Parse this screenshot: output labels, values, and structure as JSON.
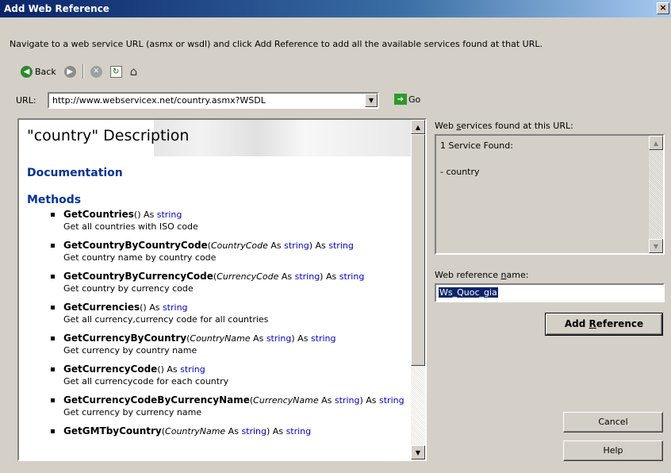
{
  "window": {
    "title": "Add Web Reference",
    "close_label": "×"
  },
  "instruction": "Navigate to a web service URL (asmx or wsdl) and click Add Reference to add all the available services found at that URL.",
  "toolbar": {
    "back_label": "Back"
  },
  "url": {
    "label": "URL:",
    "value": "http://www.webservicex.net/country.asmx?WSDL",
    "go_label": "Go"
  },
  "browser": {
    "title": "\"country\" Description",
    "documentation_heading": "Documentation",
    "methods_heading": "Methods",
    "methods": [
      {
        "name": "GetCountries",
        "params": [],
        "returns": "string",
        "description": "Get all countries with ISO code"
      },
      {
        "name": "GetCountryByCountryCode",
        "params": [
          {
            "name": "CountryCode",
            "type": "string"
          }
        ],
        "returns": "string",
        "description": "Get country name by country code"
      },
      {
        "name": "GetCountryByCurrencyCode",
        "params": [
          {
            "name": "CurrencyCode",
            "type": "string"
          }
        ],
        "returns": "string",
        "description": "Get country by currency code"
      },
      {
        "name": "GetCurrencies",
        "params": [],
        "returns": "string",
        "description": "Get all currency,currency code for all countries"
      },
      {
        "name": "GetCurrencyByCountry",
        "params": [
          {
            "name": "CountryName",
            "type": "string"
          }
        ],
        "returns": "string",
        "description": "Get currency by country name"
      },
      {
        "name": "GetCurrencyCode",
        "params": [],
        "returns": "string",
        "description": "Get all currencycode for each country"
      },
      {
        "name": "GetCurrencyCodeByCurrencyName",
        "params": [
          {
            "name": "CurrencyName",
            "type": "string"
          }
        ],
        "returns": "string",
        "description": "Get currency by currency name"
      },
      {
        "name": "GetGMTbyCountry",
        "params": [
          {
            "name": "CountryName",
            "type": "string"
          }
        ],
        "returns": "string",
        "description": ""
      }
    ]
  },
  "services": {
    "label": "Web services found at this URL:",
    "count_text": "1 Service Found:",
    "items": [
      "- country"
    ]
  },
  "reference": {
    "label": "Web reference name:",
    "value": "Ws_Quoc_gia"
  },
  "buttons": {
    "add_reference": "Add Reference",
    "cancel": "Cancel",
    "help": "Help"
  }
}
